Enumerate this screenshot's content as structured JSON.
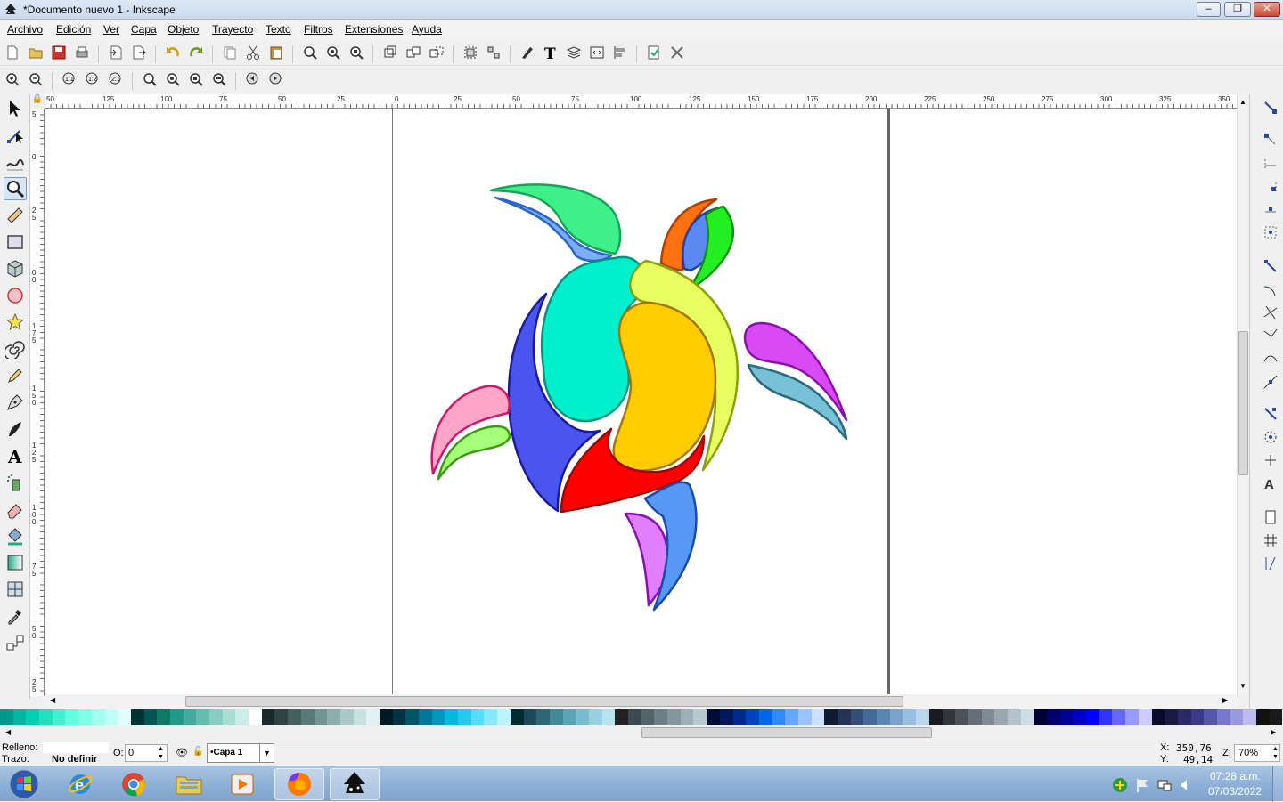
{
  "window": {
    "title": "*Documento nuevo 1 - Inkscape",
    "min": "–",
    "max": "❐",
    "close": "✕"
  },
  "menu": [
    "Archivo",
    "Edición",
    "Ver",
    "Capa",
    "Objeto",
    "Trayecto",
    "Texto",
    "Filtros",
    "Extensiones",
    "Ayuda"
  ],
  "ruler": {
    "h_labels": [
      "50",
      "125",
      "100",
      "75",
      "50",
      "25",
      "0",
      "25",
      "50",
      "75",
      "100",
      "125",
      "150",
      "175",
      "200",
      "225",
      "250",
      "275",
      "300",
      "325",
      "350"
    ],
    "v_labels": [
      "5",
      "0",
      "2",
      "5",
      "0",
      "0",
      "1",
      "7",
      "5",
      "1",
      "5",
      "0",
      "1",
      "2",
      "5",
      "1",
      "0",
      "0",
      "7",
      "5",
      "5",
      "0",
      "2",
      "5"
    ]
  },
  "status": {
    "fill_label": "Relleno:",
    "stroke_label": "Trazo:",
    "stroke_value": "No definir",
    "opacity_label": "O:",
    "opacity_value": "0",
    "layer": "•Capa 1",
    "x_label": "X:",
    "x_value": "350,76",
    "y_label": "Y:",
    "y_value": "49,14",
    "zoom_label": "Z:",
    "zoom_value": "70%"
  },
  "clock": {
    "time": "07:28 a.m.",
    "date": "07/03/2022"
  },
  "palette": [
    "#009a8a",
    "#00b8a0",
    "#00d0b0",
    "#20e0c0",
    "#40f0d0",
    "#60ffe0",
    "#80ffe8",
    "#a0fff0",
    "#c0fff8",
    "#e0fffc",
    "#003333",
    "#005555",
    "#117766",
    "#229988",
    "#44aaa0",
    "#66bbb0",
    "#88ccc4",
    "#aaddd4",
    "#ccece8",
    "#ffffff",
    "#1a2a2a",
    "#2e4444",
    "#446060",
    "#5a7a7a",
    "#739494",
    "#8eaeae",
    "#aac8c8",
    "#c6e2e2",
    "#e2f2f2",
    "#001a22",
    "#003344",
    "#005566",
    "#007799",
    "#0099bb",
    "#00bbdd",
    "#22ccee",
    "#55ddff",
    "#88e8ff",
    "#bbf4ff",
    "#002b33",
    "#1a4a5a",
    "#2e6677",
    "#428899",
    "#5aa4b8",
    "#78bcd0",
    "#98d0e0",
    "#b8e2ee",
    "#222222",
    "#3a4a50",
    "#52646a",
    "#6a7e84",
    "#82989e",
    "#9ab2b8",
    "#b4cad0",
    "#000a33",
    "#00185a",
    "#002a88",
    "#0044bb",
    "#0066ee",
    "#3388ff",
    "#66a8ff",
    "#99c4ff",
    "#cce0ff",
    "#111a33",
    "#223355",
    "#334e77",
    "#446a99",
    "#5a86b4",
    "#7aa2cc",
    "#9abedf",
    "#bcd6ee",
    "#1a1a22",
    "#33363e",
    "#4c525a",
    "#666e78",
    "#808a94",
    "#9aa6b0",
    "#b4c2cc",
    "#cedce4",
    "#000033",
    "#000066",
    "#000099",
    "#0000cc",
    "#0000ff",
    "#3333ff",
    "#6666ff",
    "#9999ff",
    "#ccccff",
    "#0a0a2a",
    "#1a1a44",
    "#2a2a66",
    "#3a3a88",
    "#5555aa",
    "#7777cc",
    "#9999dd",
    "#bbbbee",
    "#111111",
    "#1a1a1a"
  ],
  "tools": [
    "selector-tool",
    "node-tool",
    "tweak-tool",
    "zoom-tool",
    "measure-tool",
    "rect-tool",
    "3dbox-tool",
    "ellipse-tool",
    "star-tool",
    "spiral-tool",
    "pencil-tool",
    "pen-tool",
    "calligraphy-tool",
    "text-tool",
    "spray-tool",
    "eraser-tool",
    "bucket-tool",
    "gradient-tool",
    "mesh-tool",
    "dropper-tool",
    "connector-tool"
  ]
}
